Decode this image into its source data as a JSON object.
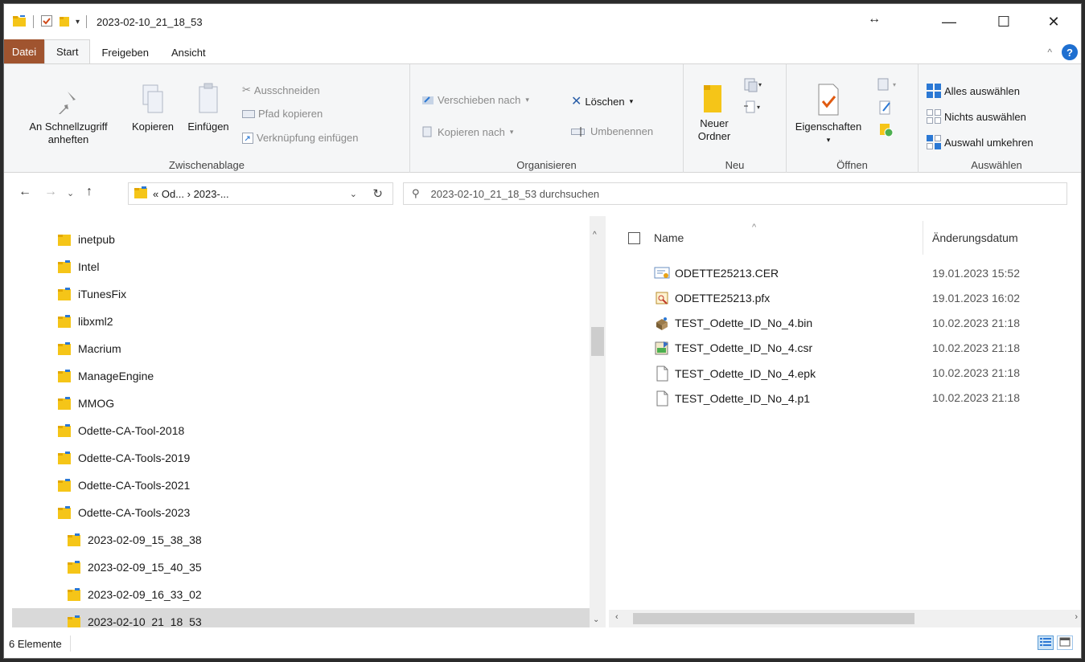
{
  "window": {
    "title": "2023-02-10_21_18_53",
    "resize_glyph": "↔",
    "controls": {
      "minimize": "—",
      "maximize": "☐",
      "close": "✕"
    }
  },
  "ribbon_tabs": [
    {
      "label": "Datei"
    },
    {
      "label": "Start"
    },
    {
      "label": "Freigeben"
    },
    {
      "label": "Ansicht"
    }
  ],
  "ribbon": {
    "clipboard": {
      "pin_label_1": "An Schnellzugriff",
      "pin_label_2": "anheften",
      "copy": "Kopieren",
      "paste": "Einfügen",
      "cut": "Ausschneiden",
      "copy_path": "Pfad kopieren",
      "paste_shortcut": "Verknüpfung einfügen",
      "group_label": "Zwischenablage"
    },
    "organize": {
      "move_to": "Verschieben nach",
      "copy_to": "Kopieren nach",
      "delete": "Löschen",
      "rename": "Umbenennen",
      "group_label": "Organisieren"
    },
    "new": {
      "new_folder_1": "Neuer",
      "new_folder_2": "Ordner",
      "group_label": "Neu"
    },
    "open": {
      "properties": "Eigenschaften",
      "group_label": "Öffnen"
    },
    "select": {
      "select_all": "Alles auswählen",
      "select_none": "Nichts auswählen",
      "invert": "Auswahl umkehren",
      "group_label": "Auswählen"
    }
  },
  "address": {
    "crumbs": "« Od...  ›  2023-...",
    "search_placeholder": "2023-02-10_21_18_53 durchsuchen"
  },
  "nav_tree": [
    {
      "label": "inetpub",
      "level": 0
    },
    {
      "label": "Intel",
      "level": 0
    },
    {
      "label": "iTunesFix",
      "level": 0
    },
    {
      "label": "libxml2",
      "level": 0
    },
    {
      "label": "Macrium",
      "level": 0
    },
    {
      "label": "ManageEngine",
      "level": 0
    },
    {
      "label": "MMOG",
      "level": 0
    },
    {
      "label": "Odette-CA-Tool-2018",
      "level": 0
    },
    {
      "label": "Odette-CA-Tools-2019",
      "level": 0
    },
    {
      "label": "Odette-CA-Tools-2021",
      "level": 0
    },
    {
      "label": "Odette-CA-Tools-2023",
      "level": 0
    },
    {
      "label": "2023-02-09_15_38_38",
      "level": 1
    },
    {
      "label": "2023-02-09_15_40_35",
      "level": 1
    },
    {
      "label": "2023-02-09_16_33_02",
      "level": 1
    },
    {
      "label": "2023-02-10_21_18_53",
      "level": 1,
      "selected": true
    }
  ],
  "file_list": {
    "columns": {
      "name": "Name",
      "date": "Änderungsdatum"
    },
    "files": [
      {
        "name": "ODETTE25213.CER",
        "date": "19.01.2023 15:52",
        "icon": "certificate-icon"
      },
      {
        "name": "ODETTE25213.pfx",
        "date": "19.01.2023 16:02",
        "icon": "pfx-icon"
      },
      {
        "name": "TEST_Odette_ID_No_4.bin",
        "date": "10.02.2023 21:18",
        "icon": "bin-icon"
      },
      {
        "name": "TEST_Odette_ID_No_4.csr",
        "date": "10.02.2023 21:18",
        "icon": "csr-icon"
      },
      {
        "name": "TEST_Odette_ID_No_4.epk",
        "date": "10.02.2023 21:18",
        "icon": "file-icon"
      },
      {
        "name": "TEST_Odette_ID_No_4.p1",
        "date": "10.02.2023 21:18",
        "icon": "file-icon"
      }
    ]
  },
  "status": {
    "count": "6 Elemente"
  },
  "colors": {
    "file_tab": "#a0542f",
    "accent": "#1e6fd0",
    "folder": "#f5c518"
  }
}
